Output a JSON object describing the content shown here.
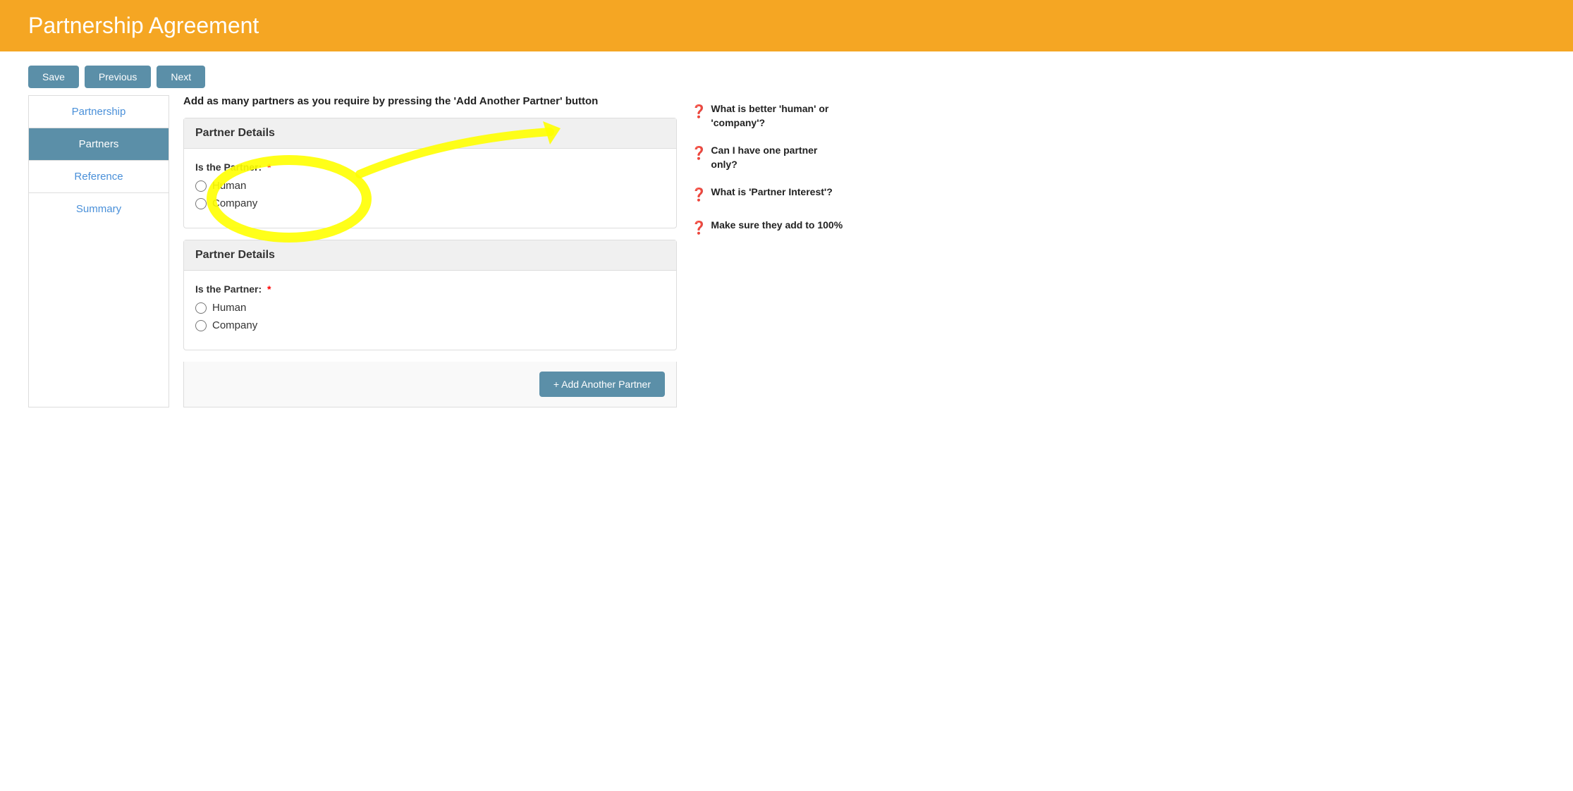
{
  "header": {
    "title": "Partnership Agreement"
  },
  "toolbar": {
    "save_label": "Save",
    "previous_label": "Previous",
    "next_label": "Next"
  },
  "sidebar": {
    "items": [
      {
        "id": "partnership",
        "label": "Partnership",
        "active": false
      },
      {
        "id": "partners",
        "label": "Partners",
        "active": true
      },
      {
        "id": "reference",
        "label": "Reference",
        "active": false
      },
      {
        "id": "summary",
        "label": "Summary",
        "active": false
      }
    ]
  },
  "content": {
    "instruction": "Add as many partners as you require by pressing the 'Add Another Partner' button",
    "partner_cards": [
      {
        "id": 1,
        "header": "Partner Details",
        "field_label": "Is the Partner:",
        "required": true,
        "options": [
          "Human",
          "Company"
        ]
      },
      {
        "id": 2,
        "header": "Partner Details",
        "field_label": "Is the Partner:",
        "required": true,
        "options": [
          "Human",
          "Company"
        ]
      }
    ],
    "add_partner_label": "+ Add Another Partner"
  },
  "help": {
    "items": [
      {
        "id": 1,
        "text": "What is better 'human' or 'company'?"
      },
      {
        "id": 2,
        "text": "Can I have one partner only?"
      },
      {
        "id": 3,
        "text": "What is 'Partner Interest'?"
      },
      {
        "id": 4,
        "text": "Make sure they add to 100%"
      }
    ]
  }
}
